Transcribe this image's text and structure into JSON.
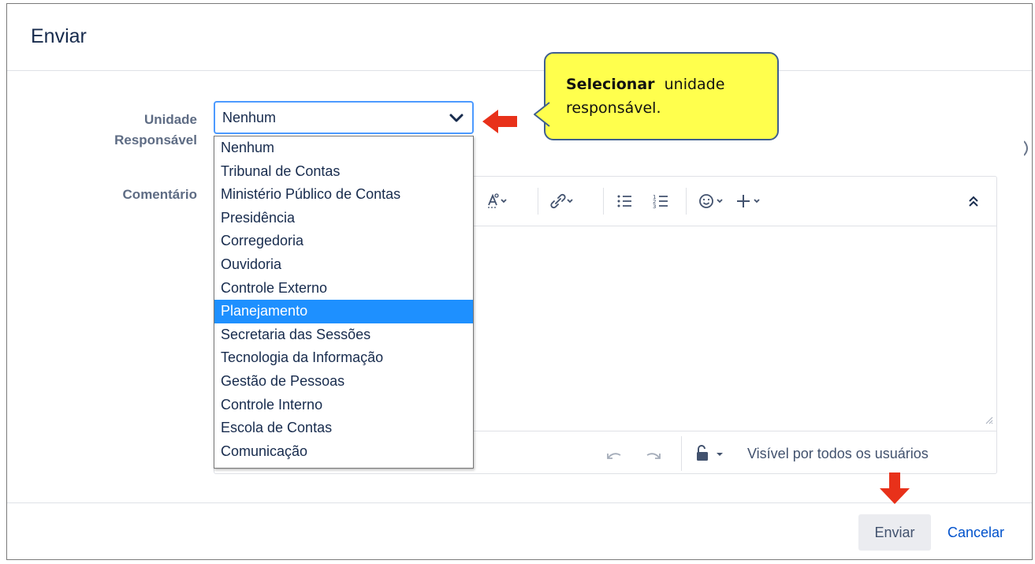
{
  "dialog": {
    "title": "Enviar",
    "unit_label_line1": "Unidade",
    "unit_label_line2": "Responsável",
    "comment_label": "Comentário"
  },
  "select": {
    "value": "Nenhum",
    "options": [
      "Nenhum",
      "Tribunal de Contas",
      "Ministério Público de Contas",
      "Presidência",
      "Corregedoria",
      "Ouvidoria",
      "Controle Externo",
      "Planejamento",
      "Secretaria das Sessões",
      "Tecnologia da Informação",
      "Gestão de Pessoas",
      "Controle Interno",
      "Escola de Contas",
      "Comunicação"
    ],
    "highlighted": "Planejamento"
  },
  "callout": {
    "bold": "Selecionar",
    "rest": "unidade responsável."
  },
  "editor": {
    "visibility": "Visível por todos os usuários"
  },
  "footer": {
    "send_label": "Enviar",
    "cancel_label": "Cancelar"
  },
  "colors": {
    "highlight": "#1e90ff",
    "callout_bg": "#ffff4d",
    "arrow": "#e8311a",
    "link": "#0052cc"
  },
  "icons": [
    "chevron-down-icon",
    "text-color-icon",
    "link-icon",
    "bullet-list-icon",
    "numbered-list-icon",
    "emoji-icon",
    "plus-icon",
    "collapse-icon",
    "undo-icon",
    "redo-icon",
    "unlock-icon",
    "caret-down-icon"
  ]
}
